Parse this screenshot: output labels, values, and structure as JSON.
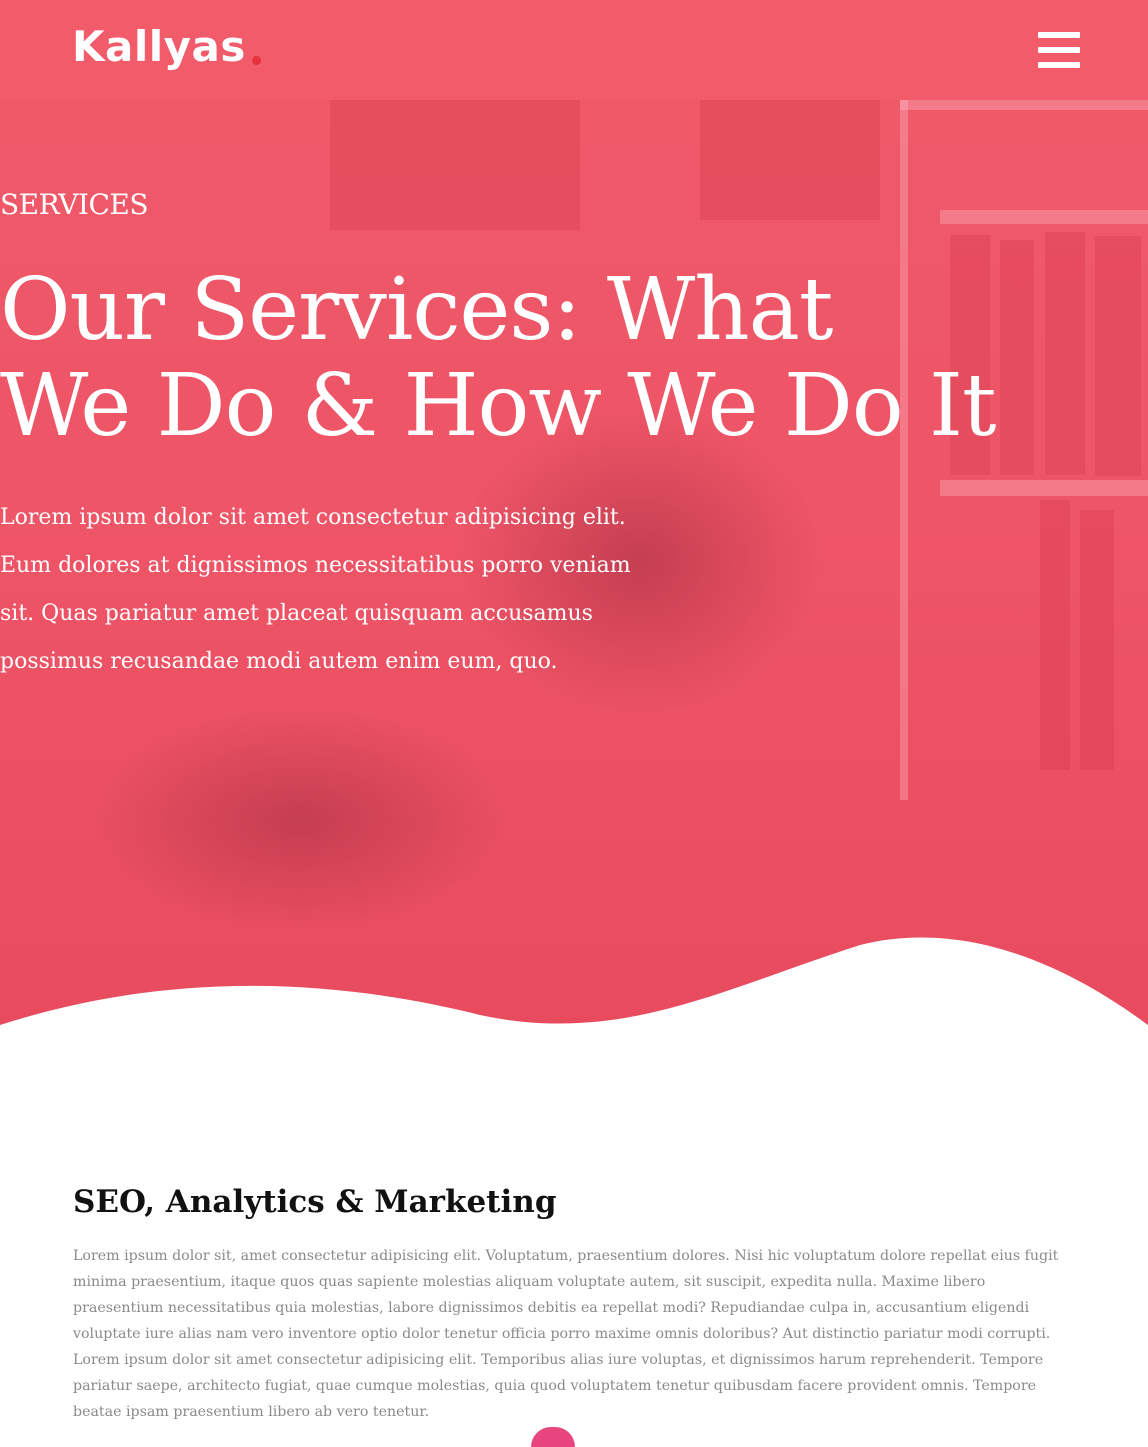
{
  "brand": {
    "name": "Kallyas",
    "accent": "#e8303f"
  },
  "nav": {
    "menu_icon": "hamburger-menu-icon"
  },
  "hero": {
    "eyebrow": "SERVICES",
    "title_line1": "Our Services: What",
    "title_line2": "We Do & How We Do It",
    "lead": "Lorem ipsum dolor sit amet consectetur adipisicing elit. Eum dolores at dignissimos necessitatibus porro veniam sit. Quas pariatur amet placeat quisquam accusamus possimus recusandae modi autem enim eum, quo.",
    "overlay_color": "#ee5567"
  },
  "section": {
    "title": "SEO, Analytics & Marketing",
    "body": "Lorem ipsum dolor sit, amet consectetur adipisicing elit. Voluptatum, praesentium dolores. Nisi hic voluptatum dolore repellat eius fugit minima praesentium, itaque quos quas sapiente molestias aliquam voluptate autem, sit suscipit, expedita nulla. Maxime libero praesentium necessitatibus quia molestias, labore dignissimos debitis ea repellat modi? Repudiandae culpa in, accusantium eligendi voluptate iure alias nam vero inventore optio dolor tenetur officia porro maxime omnis doloribus? Aut distinctio pariatur modi corrupti. Lorem ipsum dolor sit amet consectetur adipisicing elit. Temporibus alias iure voluptas, et dignissimos harum reprehenderit. Tempore pariatur saepe, architecto fugiat, quae cumque molestias, quia quod voluptatem tenetur quibusdam facere provident omnis. Tempore beatae ipsam praesentium libero ab vero tenetur."
  }
}
